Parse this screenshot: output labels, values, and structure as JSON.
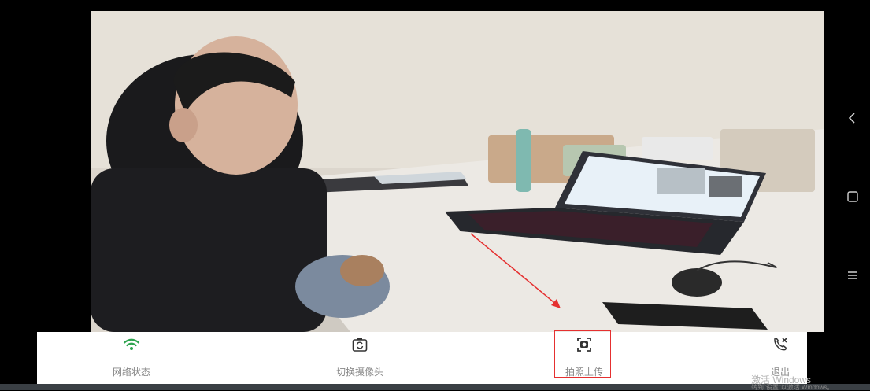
{
  "toolbar": {
    "items": [
      {
        "label": "网络状态",
        "icon": "wifi-icon"
      },
      {
        "label": "切换摄像头",
        "icon": "camera-switch-icon"
      },
      {
        "label": "拍照上传",
        "icon": "capture-icon"
      },
      {
        "label": "退出",
        "icon": "hangup-icon"
      }
    ]
  },
  "watermark": {
    "line1": "激活 Windows",
    "line2": "转到\"设置\"以激活 Windows。"
  },
  "colors": {
    "wifi": "#2ea44f",
    "highlight": "#e53030",
    "icon": "#333333",
    "label": "#888888"
  }
}
